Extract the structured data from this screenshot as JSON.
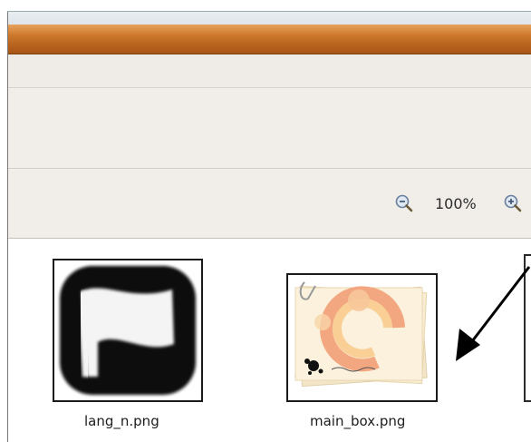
{
  "toolbar": {
    "zoom_level": "100%",
    "zoom_out_icon": "zoom-out-icon",
    "zoom_in_icon": "zoom-in-icon"
  },
  "files": [
    {
      "name": "lang_n.png",
      "icon": "flag-icon"
    },
    {
      "name": "main_box.png",
      "icon": "main-box-thumbnail"
    },
    {
      "name": "",
      "icon": "partial-thumbnail"
    }
  ],
  "annotation": {
    "arrow": "annotation-arrow"
  },
  "colors": {
    "titlebar_orange": "#cf7a2e",
    "panel_bg": "#f1eeea",
    "content_bg": "#ffffff"
  }
}
